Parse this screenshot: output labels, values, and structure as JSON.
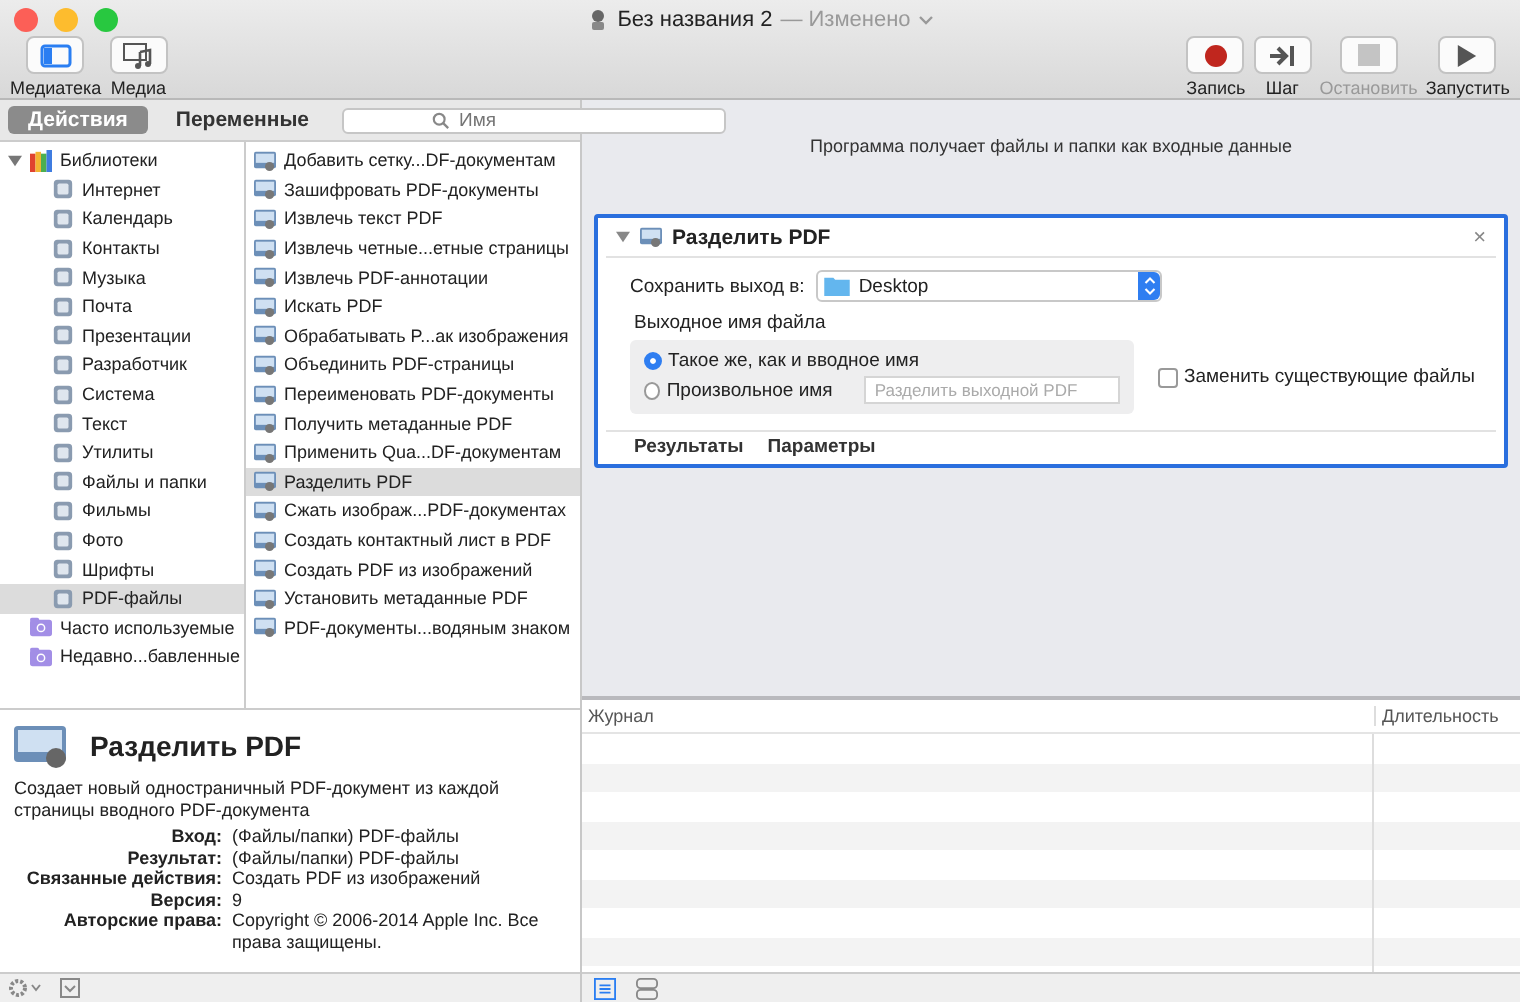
{
  "window": {
    "title": "Без названия 2",
    "status": "— Изменено"
  },
  "toolbar": {
    "left": [
      {
        "label": "Медиатека",
        "kind": "library",
        "selected": true
      },
      {
        "label": "Медиа",
        "kind": "media",
        "selected": false
      }
    ],
    "right": [
      {
        "label": "Запись",
        "kind": "record",
        "disabled": false
      },
      {
        "label": "Шаг",
        "kind": "step",
        "disabled": false
      },
      {
        "label": "Остановить",
        "kind": "stop",
        "disabled": true
      },
      {
        "label": "Запустить",
        "kind": "run",
        "disabled": false
      }
    ]
  },
  "tabs": [
    {
      "label": "Действия",
      "selected": true
    },
    {
      "label": "Переменные",
      "selected": false
    }
  ],
  "search": {
    "placeholder": "Имя"
  },
  "library": [
    {
      "label": "Библиотеки",
      "expanded": true,
      "selected": false,
      "children": [
        {
          "label": "Интернет",
          "selected": false
        },
        {
          "label": "Календарь",
          "selected": false
        },
        {
          "label": "Контакты",
          "selected": false
        },
        {
          "label": "Музыка",
          "selected": false
        },
        {
          "label": "Почта",
          "selected": false
        },
        {
          "label": "Презентации",
          "selected": false
        },
        {
          "label": "Разработчик",
          "selected": false
        },
        {
          "label": "Система",
          "selected": false
        },
        {
          "label": "Текст",
          "selected": false
        },
        {
          "label": "Утилиты",
          "selected": false
        },
        {
          "label": "Файлы и папки",
          "selected": false
        },
        {
          "label": "Фильмы",
          "selected": false
        },
        {
          "label": "Фото",
          "selected": false
        },
        {
          "label": "Шрифты",
          "selected": false
        },
        {
          "label": "PDF-файлы",
          "selected": true
        }
      ]
    },
    {
      "label": "Часто используемые",
      "selected": false
    },
    {
      "label": "Недавно...бавленные",
      "selected": false
    }
  ],
  "actions": [
    {
      "label": "Добавить сетку...DF-документам",
      "selected": false
    },
    {
      "label": "Зашифровать PDF-документы",
      "selected": false
    },
    {
      "label": "Извлечь текст PDF",
      "selected": false
    },
    {
      "label": "Извлечь четные...етные страницы",
      "selected": false
    },
    {
      "label": "Извлечь PDF-аннотации",
      "selected": false
    },
    {
      "label": "Искать PDF",
      "selected": false
    },
    {
      "label": "Обрабатывать P...ак изображения",
      "selected": false
    },
    {
      "label": "Объединить PDF-страницы",
      "selected": false
    },
    {
      "label": "Переименовать PDF-документы",
      "selected": false
    },
    {
      "label": "Получить метаданные PDF",
      "selected": false
    },
    {
      "label": "Применить Qua...DF-документам",
      "selected": false
    },
    {
      "label": "Разделить PDF",
      "selected": true
    },
    {
      "label": "Сжать изображ...PDF-документах",
      "selected": false
    },
    {
      "label": "Создать контактный лист в PDF",
      "selected": false
    },
    {
      "label": "Создать PDF из изображений",
      "selected": false
    },
    {
      "label": "Установить метаданные PDF",
      "selected": false
    },
    {
      "label": "PDF-документы...водяным знаком",
      "selected": false
    }
  ],
  "details": {
    "title": "Разделить PDF",
    "description": "Создает новый одностраничный PDF-документ из каждой страницы вводного PDF-документа",
    "fields": [
      {
        "label": "Вход:",
        "value": "(Файлы/папки) PDF-файлы"
      },
      {
        "label": "Результат:",
        "value": "(Файлы/папки) PDF-файлы"
      },
      {
        "label": "Связанные действия:",
        "value": "Создать PDF из изображений"
      },
      {
        "label": "Версия:",
        "value": "9"
      },
      {
        "label": "Авторские права:",
        "value": "Copyright © 2006-2014 Apple Inc. Все права защищены."
      }
    ]
  },
  "workflow": {
    "hint": "Программа получает файлы и папки как входные данные",
    "action": {
      "title": "Разделить PDF",
      "expanded": true,
      "close": "×",
      "save_label": "Сохранить выход в:",
      "save_value": "Desktop",
      "group_title": "Выходное имя файла",
      "options": [
        {
          "label": "Такое же, как и вводное имя",
          "selected": true
        },
        {
          "label": "Произвольное имя",
          "selected": false
        }
      ],
      "name_placeholder": "Разделить выходной PDF",
      "replace": {
        "label": "Заменить существующие файлы",
        "checked": false
      },
      "tabs": [
        "Результаты",
        "Параметры"
      ]
    }
  },
  "log": {
    "columns": [
      "Журнал",
      "Длительность"
    ]
  },
  "view_buttons": [
    {
      "kind": "list",
      "selected": true
    },
    {
      "kind": "split",
      "selected": false
    }
  ]
}
